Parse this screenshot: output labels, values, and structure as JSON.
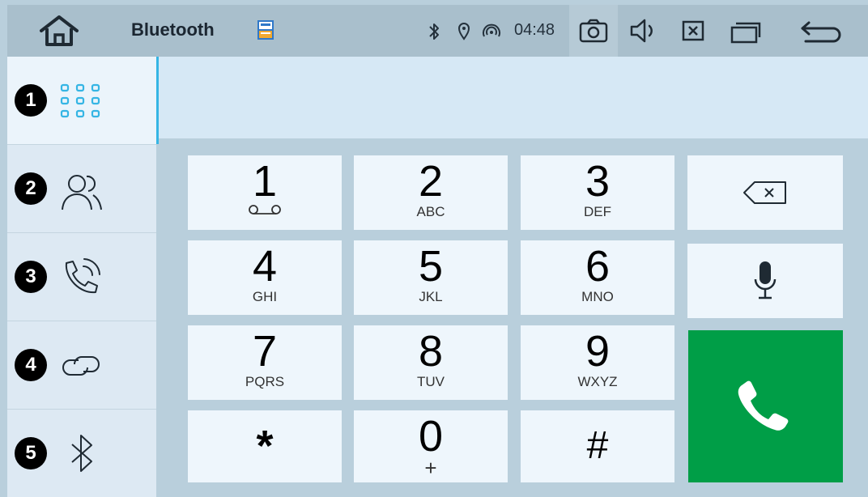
{
  "statusbar": {
    "title": "Bluetooth",
    "time": "04:48",
    "icons": [
      "home-icon",
      "app-icon",
      "bluetooth-icon",
      "location-icon",
      "hotspot-icon",
      "camera-icon",
      "volume-icon",
      "close-icon",
      "window-icon",
      "back-icon"
    ]
  },
  "sidebar": {
    "items": [
      {
        "badge": "1",
        "icon": "dialpad-icon",
        "active": true
      },
      {
        "badge": "2",
        "icon": "contacts-icon",
        "active": false
      },
      {
        "badge": "3",
        "icon": "call-log-icon",
        "active": false
      },
      {
        "badge": "4",
        "icon": "link-icon",
        "active": false
      },
      {
        "badge": "5",
        "icon": "bluetooth-icon",
        "active": false
      }
    ]
  },
  "display": {
    "number": ""
  },
  "keypad": {
    "keys": [
      {
        "digit": "1",
        "letters": "",
        "sub_icon": "voicemail-icon"
      },
      {
        "digit": "2",
        "letters": "ABC"
      },
      {
        "digit": "3",
        "letters": "DEF"
      },
      {
        "digit": "4",
        "letters": "GHI"
      },
      {
        "digit": "5",
        "letters": "JKL"
      },
      {
        "digit": "6",
        "letters": "MNO"
      },
      {
        "digit": "7",
        "letters": "PQRS"
      },
      {
        "digit": "8",
        "letters": "TUV"
      },
      {
        "digit": "9",
        "letters": "WXYZ"
      },
      {
        "digit": "*",
        "letters": ""
      },
      {
        "digit": "0",
        "letters": "+"
      },
      {
        "digit": "#",
        "letters": ""
      }
    ],
    "actions": [
      "backspace-icon",
      "microphone-icon",
      "phone-icon"
    ]
  },
  "colors": {
    "accent": "#35b5e4",
    "call": "#009e47",
    "key_bg": "#eef6fc",
    "background": "#b9cfdc"
  }
}
